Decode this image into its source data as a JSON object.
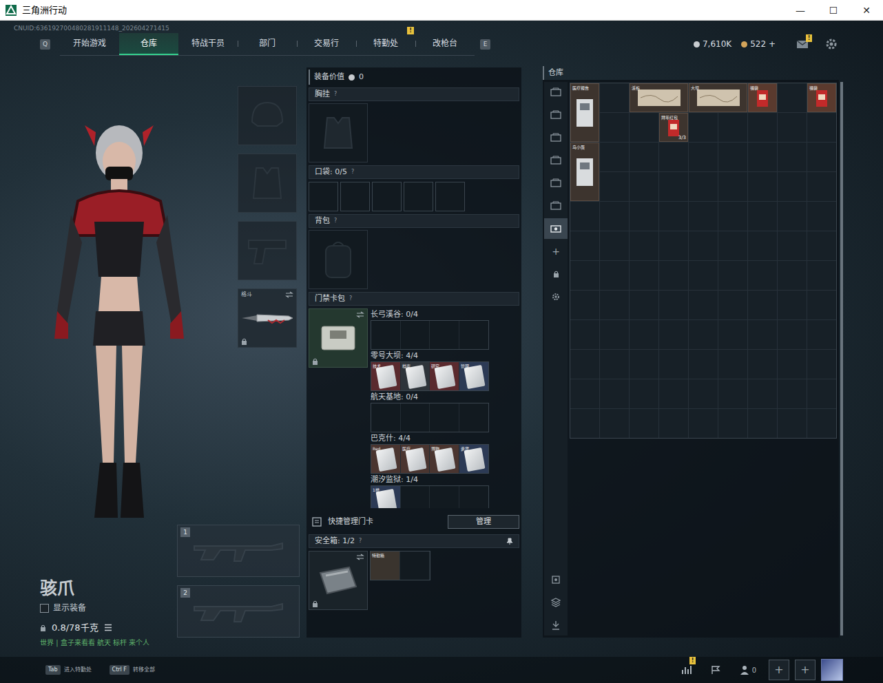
{
  "window": {
    "title": "三角洲行动",
    "controls": [
      "—",
      "☐",
      "✕"
    ]
  },
  "uid": "CNUID:636192700480281911148_202604271415",
  "nav": {
    "prev_key": "Q",
    "next_key": "E",
    "tabs": [
      {
        "label": "开始游戏",
        "selected": false
      },
      {
        "label": "仓库",
        "selected": true
      },
      {
        "label": "特战干员",
        "selected": false
      },
      {
        "label": "部门",
        "selected": false
      },
      {
        "label": "交易行",
        "selected": false
      },
      {
        "label": "特勤处",
        "selected": false,
        "badge": "!"
      },
      {
        "label": "改枪台",
        "selected": false
      }
    ],
    "currency": [
      {
        "value": "7,610K",
        "color": "#c8ccd0"
      },
      {
        "value": "522 +",
        "color": "#d4a45a"
      }
    ],
    "mail_badge": "!"
  },
  "operator": {
    "name": "骇爪",
    "show_equipment": {
      "label": "显示装备",
      "checked": false
    },
    "weight": "0.8/78千克",
    "chat": "世界 | 盒子来看看 航天 标杆 来个人"
  },
  "gear_slots": [
    {
      "kind": "helmet"
    },
    {
      "kind": "armor"
    },
    {
      "kind": "pistol"
    },
    {
      "kind": "melee",
      "label": "格斗",
      "locked": true
    }
  ],
  "weapon_slots": [
    "1",
    "2"
  ],
  "loadout": {
    "value_label": "装备价值",
    "value": "0",
    "chest": {
      "label": "胸挂",
      "help": "?"
    },
    "pockets": {
      "label": "口袋: 0/5",
      "help": "?",
      "slots": [
        false,
        false,
        false,
        false,
        false
      ]
    },
    "backpack": {
      "label": "背包",
      "help": "?"
    }
  },
  "keycards": {
    "label": "门禁卡包",
    "help": "?",
    "locked": true,
    "maps": [
      {
        "name": "长弓溪谷: 0/4",
        "cards": []
      },
      {
        "name": "零号大坝: 4/4",
        "cards": [
          {
            "label": "技术",
            "color": "#5a2a2e"
          },
          {
            "label": "档案",
            "color": "#2e343a"
          },
          {
            "label": "研究",
            "color": "#5a2a2e"
          },
          {
            "label": "管理",
            "color": "#2c3a55"
          }
        ]
      },
      {
        "name": "航天基地: 0/4",
        "cards": []
      },
      {
        "name": "巴克什: 4/4",
        "cards": [
          {
            "label": "Red",
            "color": "#4a3530"
          },
          {
            "label": "医疗",
            "color": "#4a3530"
          },
          {
            "label": "博物",
            "color": "#4a3530"
          },
          {
            "label": "贵宾",
            "color": "#2c3a55"
          }
        ]
      },
      {
        "name": "潮汐监狱: 1/4",
        "cards": [
          {
            "label": "1楼",
            "color": "#2c3a55"
          }
        ]
      }
    ],
    "manage_label": "快捷管理门卡",
    "manage_button": "管理"
  },
  "safe_box": {
    "label": "安全箱: 1/2",
    "help": "?",
    "slots": [
      {
        "filled": true,
        "label": "特勤箱"
      },
      {
        "filled": false
      }
    ]
  },
  "warehouse": {
    "title": "仓库",
    "tabs": [
      {
        "kind": "tab",
        "selected": false
      },
      {
        "kind": "tab",
        "selected": false
      },
      {
        "kind": "tab",
        "selected": false
      },
      {
        "kind": "tab",
        "selected": false
      },
      {
        "kind": "tab",
        "selected": false
      },
      {
        "kind": "tab",
        "selected": false
      },
      {
        "kind": "tab",
        "selected": true
      },
      {
        "kind": "add",
        "label": "+",
        "selected": false
      },
      {
        "kind": "lock",
        "selected": false
      },
      {
        "kind": "settings",
        "selected": false
      }
    ],
    "items": [
      {
        "label": "医疗报告"
      },
      {
        "label": "溪谷"
      },
      {
        "label": "大坝"
      },
      {
        "label": "福袋"
      },
      {
        "label": "福袋"
      },
      {
        "label": "拜年红包",
        "count": "3/3"
      },
      {
        "label": "鸟小蛋"
      }
    ]
  },
  "footer": {
    "hints": [
      {
        "key": "Tab",
        "label": "进入特勤处"
      },
      {
        "key": "Ctrl F",
        "label": "转移全部"
      }
    ],
    "stats_badge": "!",
    "friends": "0",
    "add": [
      "+",
      "+"
    ]
  }
}
